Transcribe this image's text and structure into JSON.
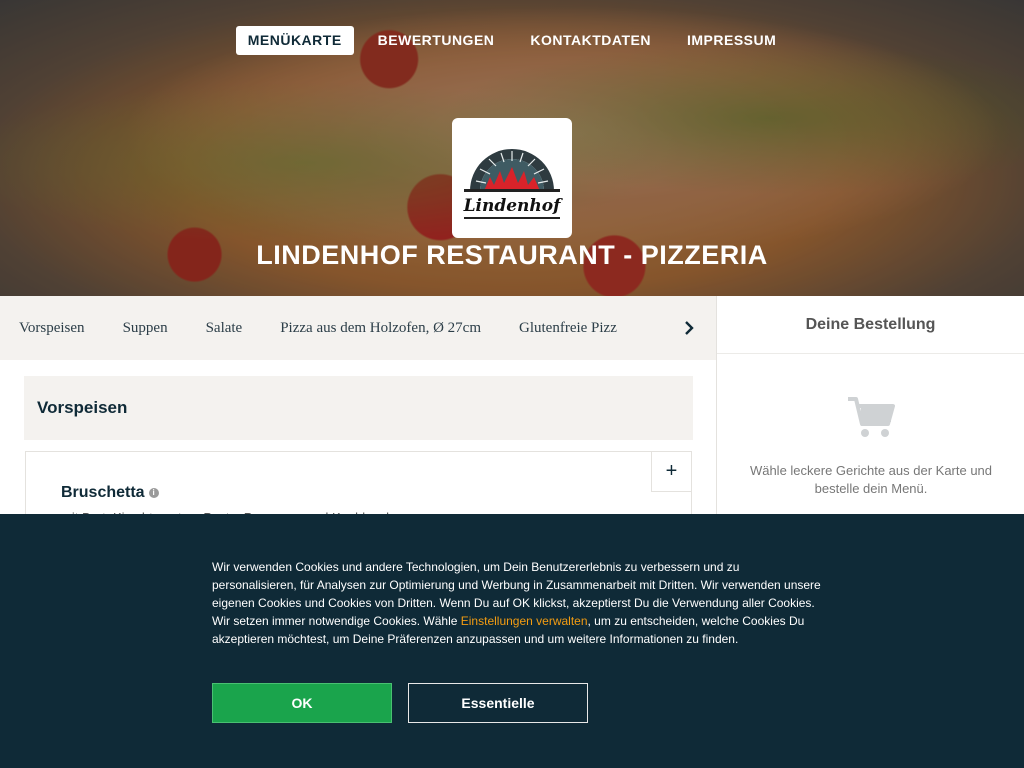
{
  "nav": {
    "items": [
      {
        "label": "MENÜKARTE",
        "active": true
      },
      {
        "label": "BEWERTUNGEN",
        "active": false
      },
      {
        "label": "KONTAKTDATEN",
        "active": false
      },
      {
        "label": "IMPRESSUM",
        "active": false
      }
    ]
  },
  "restaurant": {
    "name": "LINDENHOF RESTAURANT - PIZZERIA",
    "logo_text": "Lindenhof"
  },
  "categories": {
    "items": [
      "Vorspeisen",
      "Suppen",
      "Salate",
      "Pizza aus dem Holzofen, Ø 27cm",
      "Glutenfreie Pizz"
    ],
    "next_icon": "chevron-right-icon"
  },
  "menu": {
    "section_title": "Vorspeisen",
    "items": [
      {
        "name": "Bruschetta",
        "description": "mit Brot, Kirschtomaten, Pesto, Parmesan und Knoblauch",
        "add_label": "+"
      }
    ]
  },
  "order": {
    "title": "Deine Bestellung",
    "empty_message": "Wähle leckere Gerichte aus der Karte und bestelle dein Menü."
  },
  "cookie": {
    "text_before": "Wir verwenden Cookies und andere Technologien, um Dein Benutzererlebnis zu verbessern und zu personalisieren, für Analysen zur Optimierung und Werbung in Zusammenarbeit mit Dritten. Wir verwenden unsere eigenen Cookies und Cookies von Dritten. Wenn Du auf OK klickst, akzeptierst Du die Verwendung aller Cookies. Wir setzen immer notwendige Cookies. Wähle ",
    "link_text": "Einstellungen verwalten",
    "text_after": ", um zu entscheiden, welche Cookies Du akzeptieren möchtest, um Deine Präferenzen anzupassen und um weitere Informationen zu finden.",
    "ok_label": "OK",
    "essential_label": "Essentielle"
  },
  "colors": {
    "brand_dark": "#0f2a37",
    "ok_green": "#1aa44c",
    "link_orange": "#f39c12"
  }
}
